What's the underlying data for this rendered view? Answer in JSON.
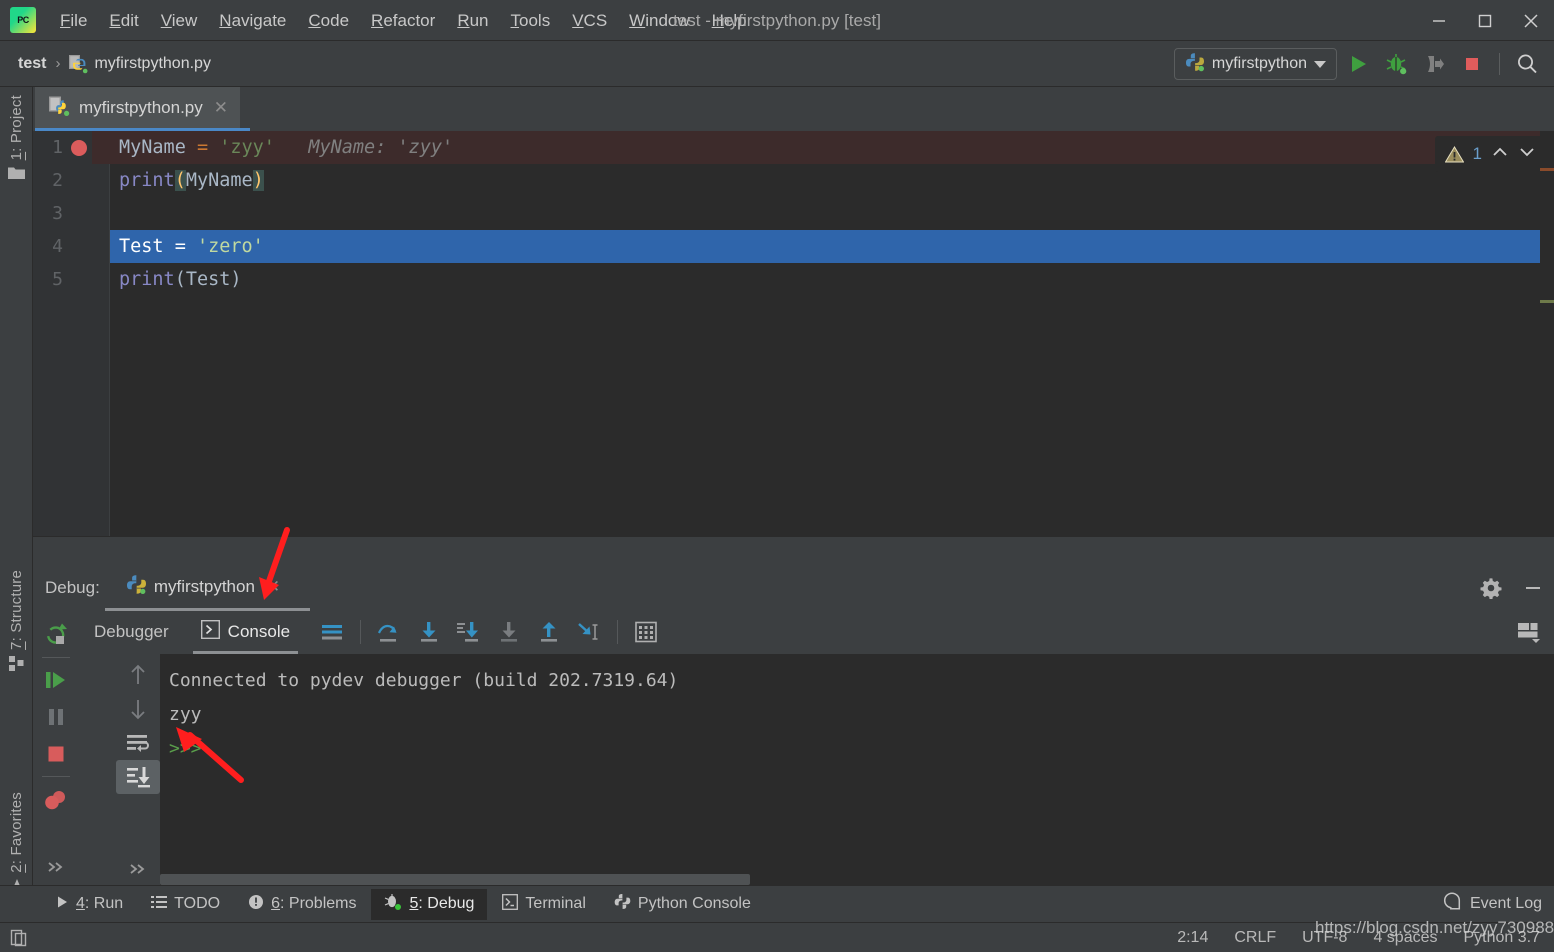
{
  "window": {
    "title": "test - myfirstpython.py [test]",
    "app_icon": "PC",
    "minimize": "─",
    "maximize": "□",
    "close": "✕"
  },
  "menubar": {
    "items": [
      {
        "label": "File",
        "mnemonic": "F"
      },
      {
        "label": "Edit",
        "mnemonic": "E"
      },
      {
        "label": "View",
        "mnemonic": "V"
      },
      {
        "label": "Navigate",
        "mnemonic": "N"
      },
      {
        "label": "Code",
        "mnemonic": "C"
      },
      {
        "label": "Refactor",
        "mnemonic": "R"
      },
      {
        "label": "Run",
        "mnemonic": "R"
      },
      {
        "label": "Tools",
        "mnemonic": "T"
      },
      {
        "label": "VCS",
        "mnemonic": "V"
      },
      {
        "label": "Window",
        "mnemonic": "W"
      },
      {
        "label": "Help",
        "mnemonic": "H"
      }
    ]
  },
  "navbar": {
    "breadcrumb": {
      "project": "test",
      "separator": "›",
      "file": "myfirstpython.py"
    },
    "run_config": "myfirstpython",
    "buttons": [
      "run-button",
      "debug-button",
      "attach-to-process-button",
      "stop-button",
      "search-everywhere-button"
    ]
  },
  "left_stripe": {
    "items": [
      {
        "label": "1: Project",
        "mnemonic": "1",
        "icon": "folder-icon"
      },
      {
        "label": "7: Structure",
        "mnemonic": "7",
        "icon": "structure-icon"
      },
      {
        "label": "2: Favorites",
        "mnemonic": "2",
        "icon": "star-icon"
      }
    ]
  },
  "editor": {
    "tab": {
      "name": "myfirstpython.py",
      "close": "✕"
    },
    "gutter_lines": [
      "1",
      "2",
      "3",
      "4",
      "5"
    ],
    "breakpoint_line": 1,
    "selected_line": 4,
    "lines": [
      {
        "n": "1",
        "text": "MyName = 'zyy'",
        "inline_hint": "MyName: 'zyy'"
      },
      {
        "n": "2",
        "text": "print(MyName)",
        "inline_hint": ""
      },
      {
        "n": "3",
        "text": "",
        "inline_hint": ""
      },
      {
        "n": "4",
        "text": "Test = 'zero'",
        "inline_hint": ""
      },
      {
        "n": "5",
        "text": "print(Test)",
        "inline_hint": ""
      }
    ],
    "inspection": {
      "count": "1",
      "up": "⌃",
      "down": "⌄"
    }
  },
  "debug_panel": {
    "title": "Debug:",
    "session_name": "myfirstpython",
    "session_close": "✕",
    "tabs": [
      {
        "label": "Debugger",
        "active": false
      },
      {
        "label": "Console",
        "active": true
      }
    ],
    "left_actions": [
      "rerun-button",
      "resume-program-button",
      "pause-program-button",
      "stop-button",
      "view-breakpoints-button",
      "more-actions-button"
    ],
    "step_actions": [
      "step-up-button",
      "step-down-button",
      "soft-wrap-button",
      "scroll-to-end-button",
      "more-actions-button"
    ],
    "console_actions": [
      "soft-wrap-lines-icon",
      "use-console-icon",
      "step-over-icon",
      "step-into-icon",
      "force-step-into-icon",
      "step-out-icon",
      "run-to-cursor-icon",
      "evaluate-expression-icon"
    ],
    "header_actions": [
      "gear-icon",
      "minimize-icon",
      "layout-settings-icon"
    ],
    "console_output": [
      {
        "text": "Connected to pydev debugger (build 202.7319.64)",
        "kind": "normal"
      },
      {
        "text": "zyy",
        "kind": "normal"
      },
      {
        "text": "",
        "kind": "normal"
      },
      {
        "text": ">>>",
        "kind": "prompt"
      }
    ]
  },
  "tool_window_bar": {
    "items": [
      {
        "label": "4: Run",
        "mnemonic": "4",
        "icon": "run-icon",
        "active": false
      },
      {
        "label": "TODO",
        "mnemonic": "",
        "icon": "todo-icon",
        "active": false
      },
      {
        "label": "6: Problems",
        "mnemonic": "6",
        "icon": "problems-icon",
        "active": false
      },
      {
        "label": "5: Debug",
        "mnemonic": "5",
        "icon": "debug-icon",
        "active": true
      },
      {
        "label": "Terminal",
        "mnemonic": "",
        "icon": "terminal-icon",
        "active": false
      },
      {
        "label": "Python Console",
        "mnemonic": "",
        "icon": "python-icon",
        "active": false
      }
    ],
    "event_log": {
      "label": "Event Log",
      "icon": "balloon-icon"
    }
  },
  "status_bar": {
    "left_icon": "toggle-toolwindows-icon",
    "caret_position": "2:14",
    "line_separator": "CRLF",
    "encoding": "UTF-8",
    "indent": "4 spaces",
    "interpreter": "Python 3.7",
    "watermark": "https://blog.csdn.net/zyy730988"
  },
  "colors": {
    "chrome": "#3c3f41",
    "editor_bg": "#2b2b2b",
    "accent_blue": "#4a88c7",
    "selection_blue": "#2f65ab",
    "breakpoint_red": "#db5c5c",
    "string_green": "#6a8759",
    "keyword_orange": "#cc7832",
    "function_purple": "#8888c6",
    "annotation_red": "#ff1e1e"
  }
}
